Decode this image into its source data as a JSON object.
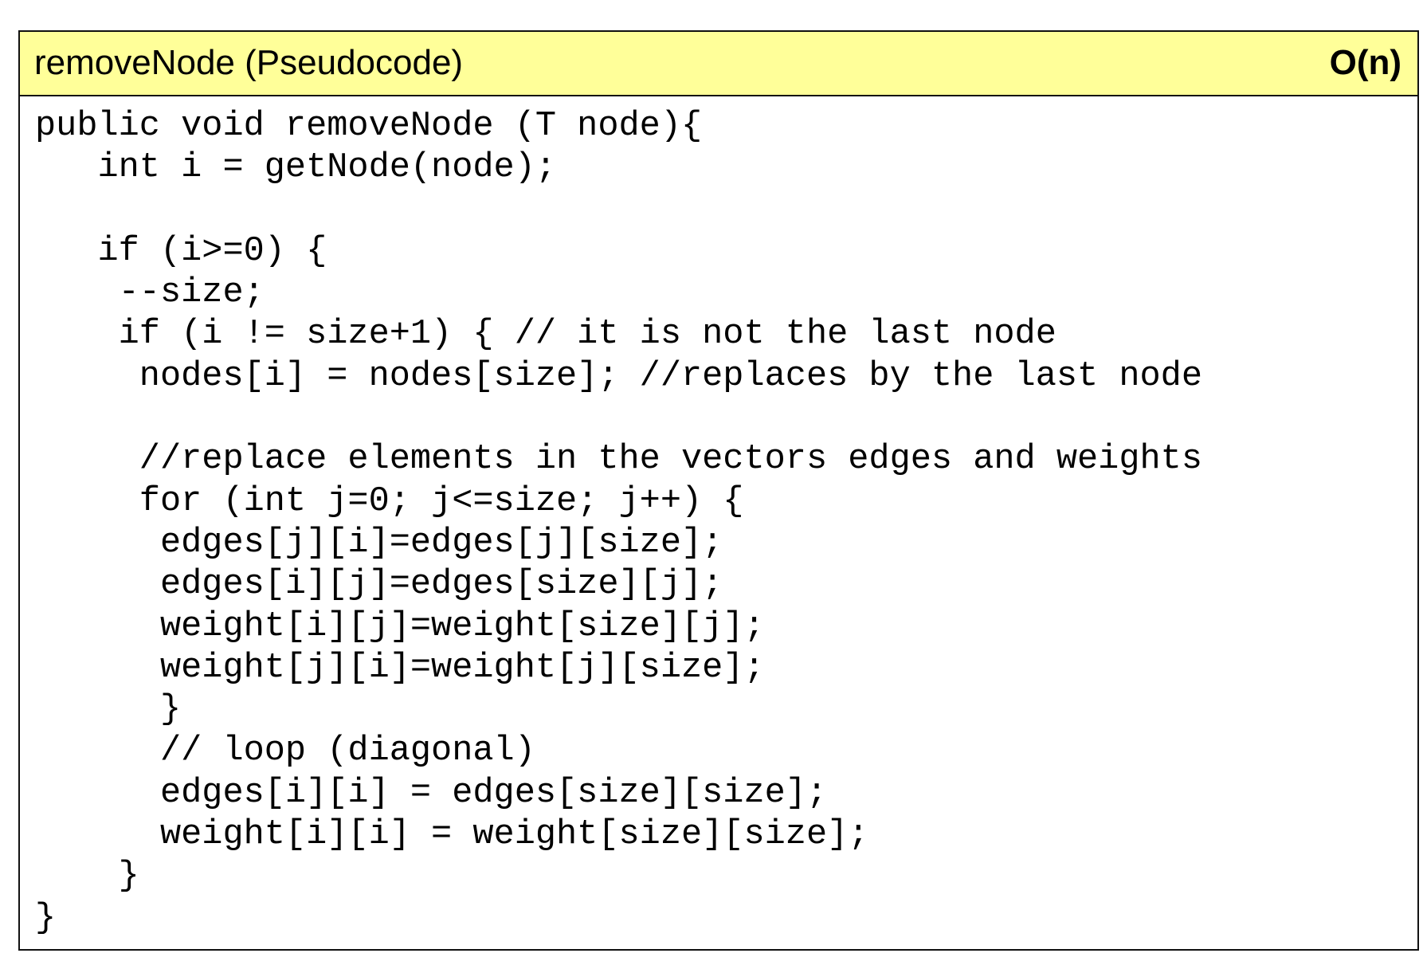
{
  "header": {
    "title": "removeNode (Pseudocode)",
    "complexity": "O(n)",
    "background_color": "#ffff99"
  },
  "code_lines": [
    "public void removeNode (T node){",
    "   int i = getNode(node);",
    "",
    "   if (i>=0) {",
    "    --size;",
    "    if (i != size+1) { // it is not the last node",
    "     nodes[i] = nodes[size]; //replaces by the last node",
    "",
    "     //replace elements in the vectors edges and weights",
    "     for (int j=0; j<=size; j++) {",
    "      edges[j][i]=edges[j][size];",
    "      edges[i][j]=edges[size][j];",
    "      weight[i][j]=weight[size][j];",
    "      weight[j][i]=weight[j][size];",
    "      }",
    "      // loop (diagonal)",
    "      edges[i][i] = edges[size][size];",
    "      weight[i][i] = weight[size][size];",
    "    }",
    "}"
  ]
}
